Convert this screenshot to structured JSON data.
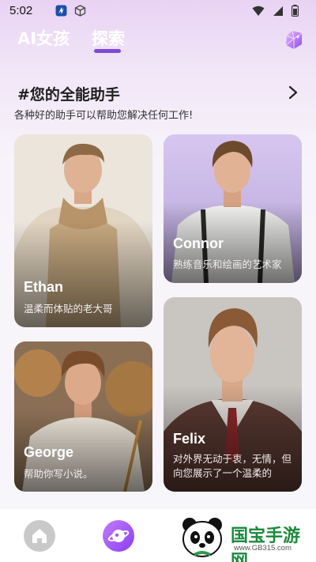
{
  "status_bar": {
    "time": "5:02",
    "icons_left": [
      "app-notification-icon",
      "cube-icon"
    ],
    "icons_right": [
      "wifi-icon",
      "signal-icon",
      "battery-icon"
    ]
  },
  "header": {
    "tabs": [
      {
        "label": "AI女孩",
        "active": false
      },
      {
        "label": "探索",
        "active": true
      }
    ],
    "action_icon": "gem-icon",
    "accent_color": "#7f4ad6"
  },
  "section": {
    "title": "#您的全能助手",
    "subtitle": "各种好的助手可以帮助您解决任何工作!",
    "more_icon": "chevron-right-icon"
  },
  "characters": [
    {
      "name": "Ethan",
      "description": "温柔而体贴的老大哥"
    },
    {
      "name": "Connor",
      "description": "熟练音乐和绘画的艺术家"
    },
    {
      "name": "George",
      "description": "帮助你写小说。"
    },
    {
      "name": "Felix",
      "description": "对外界无动于衷，无情，但向您展示了一个温柔的"
    }
  ],
  "bottom_nav": {
    "items": [
      {
        "icon": "home-icon",
        "active": false
      },
      {
        "icon": "planet-icon",
        "active": true
      }
    ]
  },
  "watermark": {
    "text": "国宝手游网",
    "url": "www.GB315.com"
  }
}
